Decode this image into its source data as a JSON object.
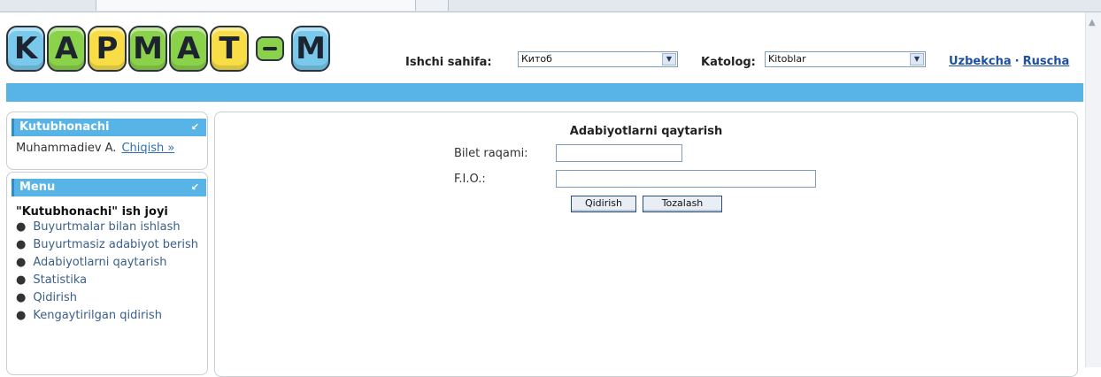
{
  "logo": {
    "letters": [
      "K",
      "A",
      "P",
      "M",
      "A",
      "T",
      "M"
    ]
  },
  "header": {
    "worksheet_label": "Ishchi sahifa:",
    "worksheet_value": "Китоб",
    "catalog_label": "Katolog:",
    "catalog_value": "Kitoblar",
    "lang_uz": "Uzbekcha",
    "lang_sep": "·",
    "lang_ru": "Ruscha"
  },
  "librarian_panel": {
    "title": "Kutubhonachi",
    "user_name": "Muhammadiev A.",
    "logout": "Chiqish »"
  },
  "menu_panel": {
    "title": "Menu",
    "heading": "\"Kutubhonachi\" ish joyi",
    "items": [
      "Buyurtmalar bilan ishlash",
      "Buyurtmasiz adabiyot berish",
      "Adabiyotlarni qaytarish",
      "Statistika",
      "Qidirish",
      "Kengaytirilgan qidirish"
    ]
  },
  "main": {
    "title": "Adabiyotlarni qaytarish",
    "ticket_label": "Bilet raqami:",
    "ticket_value": "",
    "fio_label": "F.I.O.:",
    "fio_value": "",
    "search_button": "Qidirish",
    "clear_button": "Tozalash"
  },
  "colors": {
    "accent_blue": "#58b4e6",
    "link": "#1d4fa3"
  }
}
